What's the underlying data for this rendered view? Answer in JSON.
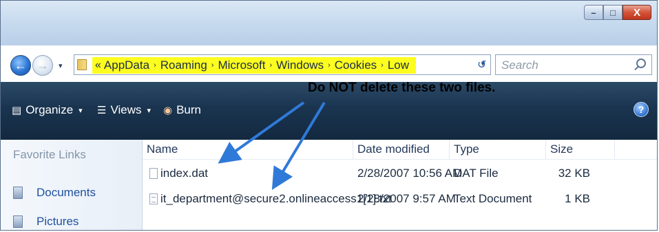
{
  "window": {
    "controls": {
      "minimize": "–",
      "maximize": "□",
      "close": "X"
    }
  },
  "nav": {
    "back_icon": "←",
    "forward_icon": "→",
    "dropdown": "▾"
  },
  "address": {
    "prefix": "«",
    "breadcrumbs": [
      "AppData",
      "Roaming",
      "Microsoft",
      "Windows",
      "Cookies",
      "Low"
    ],
    "separator": "›",
    "dropdown": "▾",
    "refresh": "↺"
  },
  "search": {
    "placeholder": "Search"
  },
  "toolbar": {
    "organize": "Organize",
    "views": "Views",
    "burn": "Burn",
    "dropdown": "▾",
    "help": "?"
  },
  "annotation": {
    "text": "Do NOT delete these two files."
  },
  "navpane": {
    "heading": "Favorite Links",
    "links": [
      "Documents",
      "Pictures"
    ]
  },
  "filelist": {
    "columns": [
      "Name",
      "Date modified",
      "Type",
      "Size"
    ],
    "rows": [
      {
        "name": "index.dat",
        "date": "2/28/2007 10:56 AM",
        "type": "DAT File",
        "size": "32 KB"
      },
      {
        "name": "it_department@secure2.onlineaccess1[1].txt",
        "date": "2/28/2007 9:57 AM",
        "type": "Text Document",
        "size": "1 KB"
      }
    ]
  },
  "colors": {
    "highlight": "#fdfd20",
    "toolbar": "#1a3450",
    "arrow": "#2f7ad8"
  }
}
